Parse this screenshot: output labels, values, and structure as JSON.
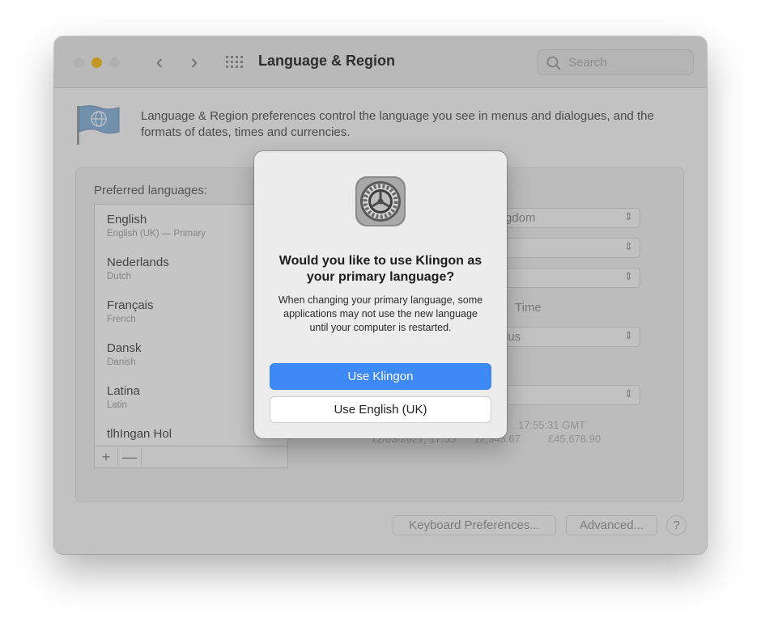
{
  "window": {
    "title": "Language & Region",
    "search_placeholder": "Search",
    "description": "Language & Region preferences control the language you see in menus and dialogues, and the formats of dates, times and currencies."
  },
  "languages": {
    "label": "Preferred languages:",
    "items": [
      {
        "name": "English",
        "sub": "English (UK) — Primary"
      },
      {
        "name": "Nederlands",
        "sub": "Dutch"
      },
      {
        "name": "Français",
        "sub": "French"
      },
      {
        "name": "Dansk",
        "sub": "Danish"
      },
      {
        "name": "Latina",
        "sub": "Latin"
      },
      {
        "name": "tlhIngan Hol",
        "sub": ""
      }
    ],
    "add": "+",
    "remove": "—"
  },
  "settings": {
    "region_fragment": "gdom",
    "time_fragment": "Time",
    "temperature_fragment": "ius",
    "sample_time": "17:55:31 GMT",
    "sample_date": "12/03/2021, 17:55",
    "sample_number": "12,345.67",
    "sample_currency": "£45,678.90"
  },
  "buttons": {
    "keyboard": "Keyboard Preferences...",
    "advanced": "Advanced...",
    "help": "?"
  },
  "dialog": {
    "title": "Would you like to use Klingon as your primary language?",
    "body": "When changing your primary language, some applications may not use the new language until your computer is restarted.",
    "primary": "Use Klingon",
    "secondary": "Use English (UK)"
  },
  "icons": {
    "app": "system-preferences-gear-icon",
    "pane": "globe-flag-icon",
    "search": "magnifier-icon"
  },
  "colors": {
    "accent": "#3d8af7",
    "traffic_minimize": "#f6bf2f"
  }
}
